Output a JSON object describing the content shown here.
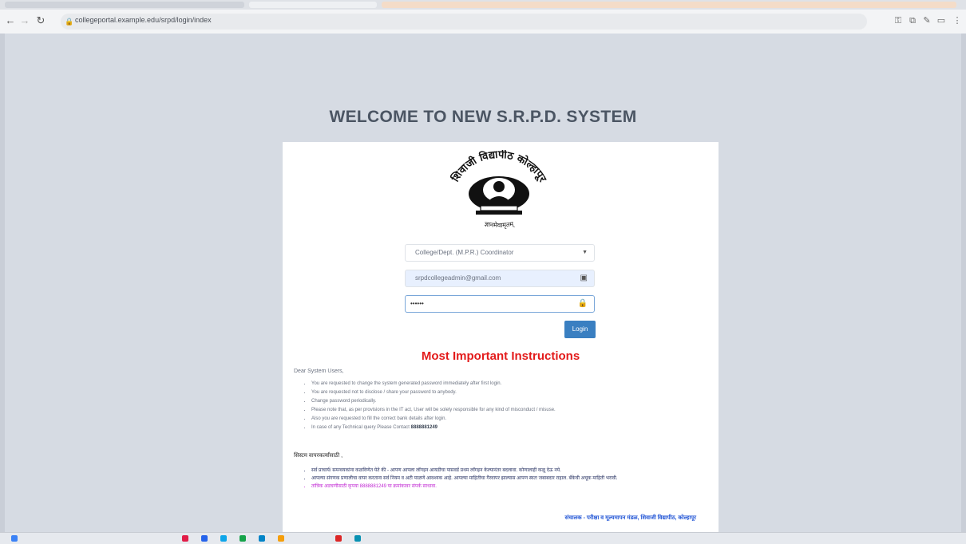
{
  "browser": {
    "url": "collegeportal.example.edu/srpd/login/index",
    "nav_icons": [
      "back-icon",
      "forward-icon",
      "reload-icon",
      "lock-icon"
    ],
    "toolbar_icons": [
      "key-icon",
      "extensions-icon",
      "edit-icon",
      "panel-icon",
      "menu-icon"
    ]
  },
  "page": {
    "welcome_title": "WELCOME TO NEW S.R.P.D. SYSTEM",
    "logo": {
      "name": "university-seal",
      "top_text": "शिवाजी विद्यापीठ कोल्हापूर",
      "bottom_text": "ज्ञानमेवामृतम्"
    }
  },
  "form": {
    "category_select": "College/Dept. (M.P.R.) Coordinator",
    "email_value": "srpdcollegeadmin@gmail.com",
    "password_value": "••••••",
    "login_label": "Login",
    "icons": {
      "select": "chevron-down-icon",
      "email": "id-card-icon",
      "password": "lock-icon"
    }
  },
  "instructions": {
    "heading": "Most Important Instructions",
    "greeting": "Dear System Users,",
    "items": [
      "You are requested to change the system generated password immediately after first login.",
      "You are requested not to disclose / share your password to anybody.",
      "Change password periodically.",
      "Please note that, as per provisions in the IT act, User will be solely responsible for any kind of misconduct / misuse.",
      "Also you are requested to fill the correct bank details after login.",
      "In case of any Technical query Please Contact 8888881249"
    ],
    "contact_number": "8888881249",
    "marathi_heading": "सिस्टम वापरकर्त्यांसाठी ,",
    "marathi_items": [
      "सर्व प्राचार्य/ समन्वयकांना कळविणेत येते की - आपण आपला लॉगइन आयडीचा पासवर्ड प्रथम लॉगइन केल्यानंतर बदलावा. कोणालाही कळू देऊ नये.",
      "आपल्या संगणक प्रणालीचा वापर करताना सर्व नियम व अटी पाळणे आवश्यक आहे. आपल्या माहितीचा गैरवापर झाल्यास आपण स्वतः जबाबदार राहाल. बँकेची अचूक माहिती भरावी.",
      "तांत्रिक अडचणीसाठी कृपया 8888881249 या क्रमांकावर संपर्क साधावा."
    ],
    "signoff": "संचालक - परीक्षा व मूल्यमापन मंडळ, शिवाजी विद्यापीठ, कोल्हापूर"
  },
  "colors": {
    "background": "#d6dbe3",
    "heading_red": "#e31b1b",
    "button_blue": "#3a7fc1",
    "signoff_blue": "#2457d6",
    "pink": "#c026d3"
  }
}
